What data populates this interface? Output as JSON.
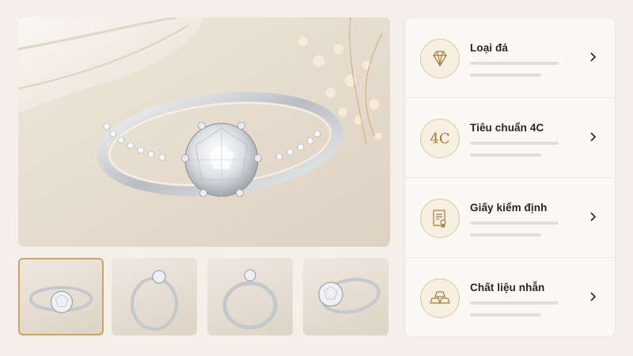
{
  "gallery": {
    "main_image": "ring-front-view",
    "thumbnails": [
      {
        "view": "ring-front",
        "selected": true
      },
      {
        "view": "ring-side",
        "selected": false
      },
      {
        "view": "ring-back",
        "selected": false
      },
      {
        "view": "ring-angle",
        "selected": false
      }
    ]
  },
  "info_panel": {
    "items": [
      {
        "label": "Loại đá",
        "icon": "diamond-icon"
      },
      {
        "label": "Tiêu chuẩn 4C",
        "icon": "4c-icon",
        "icon_text": "4C"
      },
      {
        "label": "Giấy kiểm định",
        "icon": "certificate-icon"
      },
      {
        "label": "Chất liệu nhẫn",
        "icon": "gold-bars-icon"
      }
    ]
  },
  "colors": {
    "accent": "#a47a3c",
    "background": "#f4efe8",
    "panel": "#fbf9f6"
  }
}
